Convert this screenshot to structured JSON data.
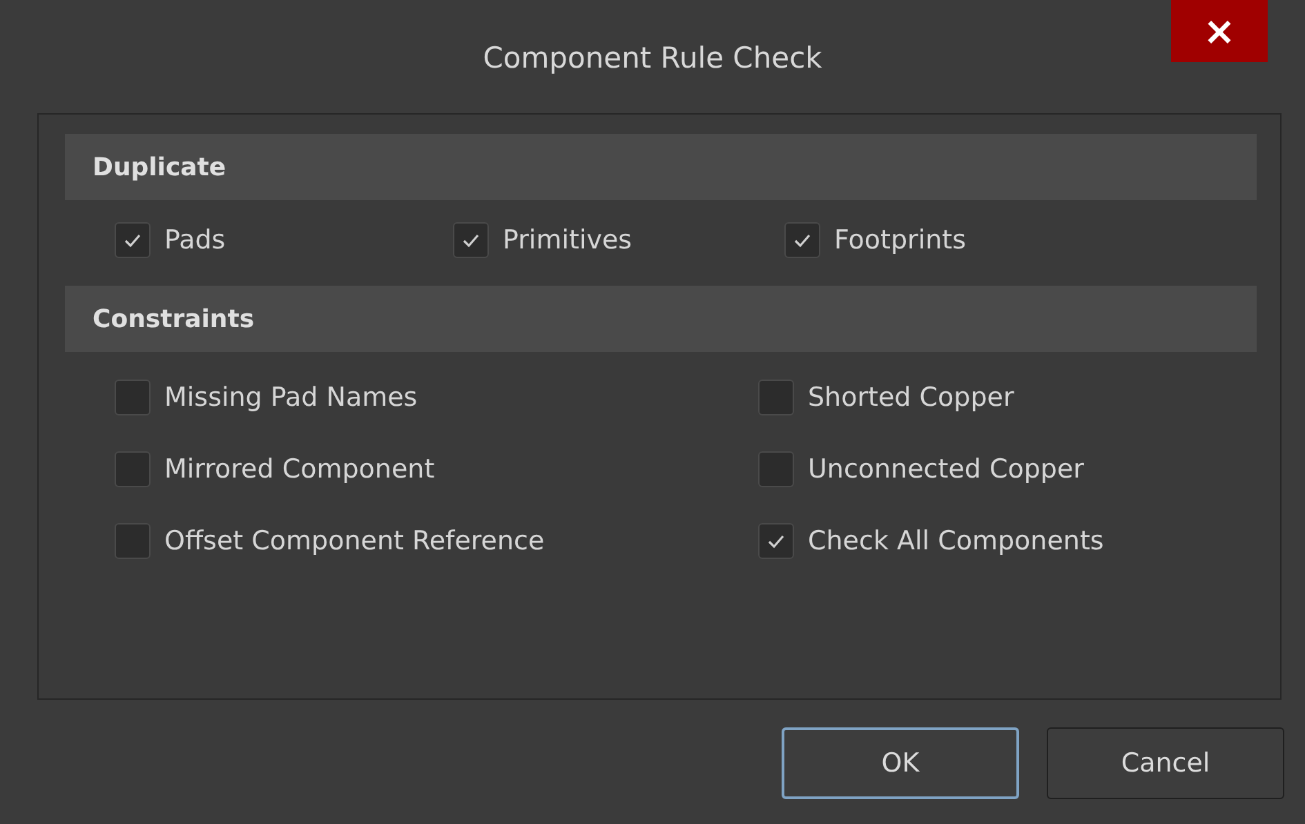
{
  "window": {
    "title": "Component Rule Check",
    "close": "×"
  },
  "sections": [
    {
      "title": "Duplicate",
      "kind": "row",
      "items": [
        {
          "label": "Pads",
          "checked": true
        },
        {
          "label": "Primitives",
          "checked": true
        },
        {
          "label": "Footprints",
          "checked": true
        }
      ]
    },
    {
      "title": "Constraints",
      "kind": "grid",
      "items": [
        {
          "label": "Missing Pad Names",
          "checked": false
        },
        {
          "label": "Shorted Copper",
          "checked": false
        },
        {
          "label": "Mirrored Component",
          "checked": false
        },
        {
          "label": "Unconnected Copper",
          "checked": false
        },
        {
          "label": "Offset Component Reference",
          "checked": false
        },
        {
          "label": "Check All Components",
          "checked": true
        }
      ]
    }
  ],
  "buttons": [
    {
      "label": "OK",
      "default": true
    },
    {
      "label": "Cancel",
      "default": false
    }
  ]
}
